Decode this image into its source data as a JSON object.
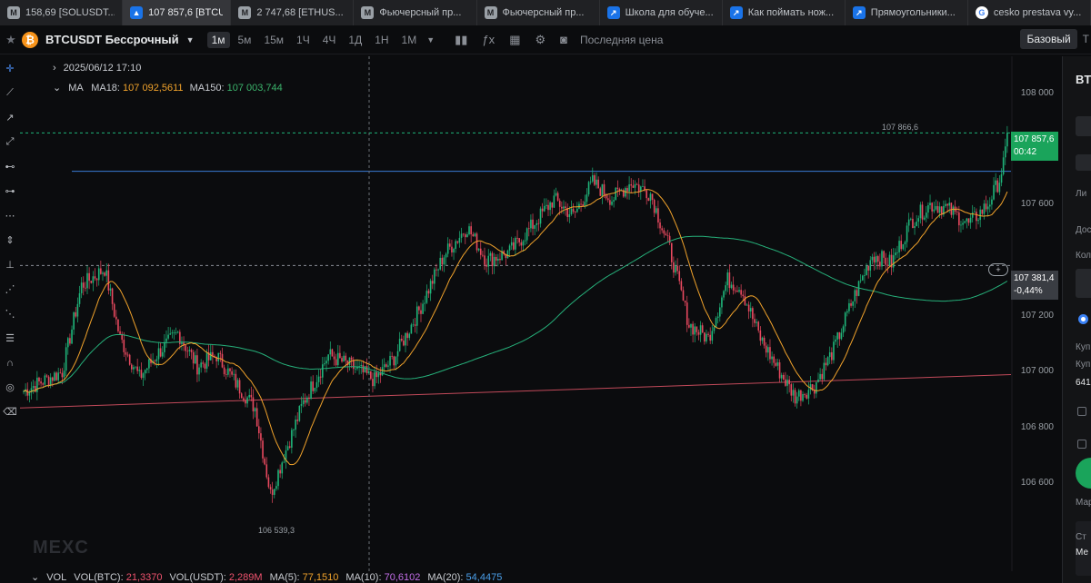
{
  "browser_tabs": [
    {
      "label": "158,69 [SOLUSDT...",
      "icon": "mexc-icon",
      "kind": "grey",
      "glyph": "M"
    },
    {
      "label": "107 857,6 [BTCUS...",
      "icon": "mexc-active-icon",
      "kind": "blue",
      "glyph": "▲",
      "active": true
    },
    {
      "label": "2 747,68 [ETHUS...",
      "icon": "mexc-icon",
      "kind": "grey",
      "glyph": "M"
    },
    {
      "label": "Фьючерсный пр...",
      "icon": "mexc-icon",
      "kind": "grey",
      "glyph": "M"
    },
    {
      "label": "Фьючерсный пр...",
      "icon": "mexc-icon",
      "kind": "grey",
      "glyph": "M"
    },
    {
      "label": "Школа для обуче...",
      "icon": "chart-arrow-icon",
      "kind": "blue",
      "glyph": "↗"
    },
    {
      "label": "Как поймать нож...",
      "icon": "chart-arrow-icon",
      "kind": "blue",
      "glyph": "↗"
    },
    {
      "label": "Прямоугольники...",
      "icon": "chart-arrow-icon",
      "kind": "blue",
      "glyph": "↗"
    },
    {
      "label": "cesko prestava vy...",
      "icon": "google-icon",
      "kind": "google",
      "glyph": "G"
    }
  ],
  "toolbar": {
    "coin_glyph": "₿",
    "symbol": "BTCUSDT Бессрочный",
    "timeframes": [
      "1м",
      "5м",
      "15м",
      "1Ч",
      "4Ч",
      "1Д",
      "1Н",
      "1М"
    ],
    "active_timeframe": "1м",
    "price_type": "Последняя цена",
    "base_label": "Базовый",
    "tv_label": "T"
  },
  "legend": {
    "datetime": "2025/06/12 17:10",
    "ma_label": "MA",
    "ma18_label": "MA18:",
    "ma18_value": "107 092,5611",
    "ma150_label": "MA150:",
    "ma150_value": "107 003,744"
  },
  "volume_legend": {
    "vol": "VOL",
    "vol_btc_label": "VOL(BTC):",
    "vol_btc": "21,3370",
    "vol_usdt_label": "VOL(USDT):",
    "vol_usdt": "2,289M",
    "ma5_label": "MA(5):",
    "ma5": "77,1510",
    "ma10_label": "MA(10):",
    "ma10": "70,6102",
    "ma20_label": "MA(20):",
    "ma20": "54,4475"
  },
  "price_axis": {
    "ticks": [
      "108 000",
      "107 600",
      "107 200",
      "107 000",
      "106 800",
      "106 600"
    ],
    "tick_values": [
      108000,
      107600,
      107200,
      107000,
      106800,
      106600
    ],
    "last_price": "107 857,6",
    "countdown": "00:42",
    "cursor_price": "107 381,4",
    "cursor_change": "-0,44%",
    "high_annotation": "107 866,6",
    "low_annotation": "106 539,3"
  },
  "chart_data": {
    "type": "candlestick",
    "ylim": [
      106470,
      108100
    ],
    "last_price": 107857.6,
    "high": 107866.6,
    "low": 106539.3,
    "cursor_price": 107381.4,
    "horizontal_line": 107720,
    "waypoints": [
      [
        0,
        106930
      ],
      [
        8,
        106960
      ],
      [
        20,
        107000
      ],
      [
        30,
        107310
      ],
      [
        42,
        107370
      ],
      [
        50,
        107120
      ],
      [
        60,
        106980
      ],
      [
        70,
        107070
      ],
      [
        80,
        107140
      ],
      [
        90,
        107020
      ],
      [
        100,
        107060
      ],
      [
        110,
        106960
      ],
      [
        120,
        106870
      ],
      [
        128,
        106560
      ],
      [
        135,
        106700
      ],
      [
        145,
        106890
      ],
      [
        158,
        107060
      ],
      [
        170,
        107020
      ],
      [
        182,
        106970
      ],
      [
        192,
        107050
      ],
      [
        205,
        107220
      ],
      [
        218,
        107420
      ],
      [
        230,
        107520
      ],
      [
        240,
        107400
      ],
      [
        252,
        107430
      ],
      [
        262,
        107510
      ],
      [
        275,
        107620
      ],
      [
        285,
        107560
      ],
      [
        295,
        107680
      ],
      [
        305,
        107620
      ],
      [
        315,
        107680
      ],
      [
        325,
        107640
      ],
      [
        335,
        107440
      ],
      [
        345,
        107170
      ],
      [
        355,
        107120
      ],
      [
        365,
        107330
      ],
      [
        372,
        107300
      ],
      [
        382,
        107120
      ],
      [
        392,
        107000
      ],
      [
        400,
        106910
      ],
      [
        410,
        106950
      ],
      [
        420,
        107080
      ],
      [
        430,
        107260
      ],
      [
        440,
        107420
      ],
      [
        450,
        107390
      ],
      [
        460,
        107540
      ],
      [
        470,
        107600
      ],
      [
        478,
        107590
      ],
      [
        490,
        107530
      ],
      [
        500,
        107600
      ],
      [
        506,
        107690
      ],
      [
        510,
        107810
      ]
    ],
    "ma18_color": "#f0a22b",
    "ma150_color": "#26b07a",
    "trend_line_color": "#c24a5a",
    "hline_color": "#3a7bd5",
    "up_color": "#1fb57a",
    "down_color": "#e8495f"
  },
  "watermark": "MEXC",
  "right_panel": {
    "title": "BT",
    "row1": "Ли",
    "row2": "Дос",
    "row3": "Кол",
    "row4": "Куп",
    "row5": "Куп",
    "row6": "641",
    "row7": "Мар",
    "row8": "Ст",
    "row9": "Ме"
  }
}
